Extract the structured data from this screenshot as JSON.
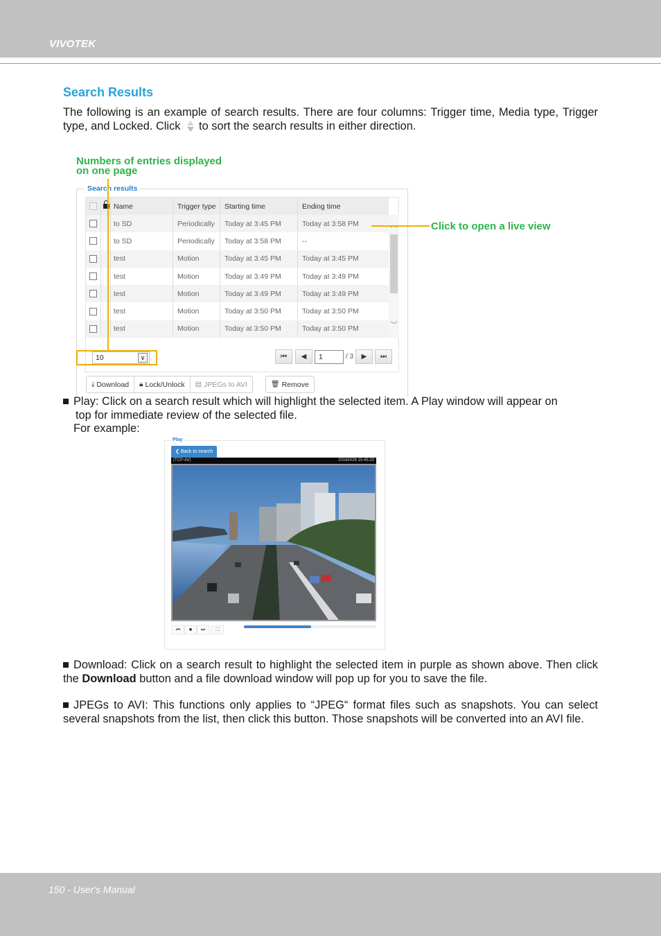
{
  "header": {
    "brand": "VIVOTEK"
  },
  "footer": {
    "page_label": "150 - User's Manual"
  },
  "section": {
    "title": "Search Results",
    "intro_part1": "The following is an example of search results. There are four columns: Trigger time, Media type, Trigger type, and Locked. Click",
    "intro_part2": "to sort the search results in either direction.",
    "sort_icon": "sort-up-down-icon"
  },
  "annotations": {
    "entries_per_page_line1": "Numbers of entries displayed",
    "entries_per_page_line2": "on one page",
    "live_view": "Click to open a live view",
    "accent_color": "#2db34a",
    "callout_color": "#f0ae00"
  },
  "search_panel": {
    "legend": "Search results",
    "columns": [
      "Name",
      "Trigger type",
      "Starting time",
      "Ending time"
    ],
    "rows": [
      {
        "name": "to SD",
        "trigger": "Periodically",
        "start": "Today at 3:45 PM",
        "end": "Today at 3:58 PM"
      },
      {
        "name": "to SD",
        "trigger": "Periodically",
        "start": "Today at 3:58 PM",
        "end": "--"
      },
      {
        "name": "test",
        "trigger": "Motion",
        "start": "Today at 3:45 PM",
        "end": "Today at 3:45 PM"
      },
      {
        "name": "test",
        "trigger": "Motion",
        "start": "Today at 3:49 PM",
        "end": "Today at 3:49 PM"
      },
      {
        "name": "test",
        "trigger": "Motion",
        "start": "Today at 3:49 PM",
        "end": "Today at 3:49 PM"
      },
      {
        "name": "test",
        "trigger": "Motion",
        "start": "Today at 3:50 PM",
        "end": "Today at 3:50 PM"
      },
      {
        "name": "test",
        "trigger": "Motion",
        "start": "Today at 3:50 PM",
        "end": "Today at 3:50 PM"
      }
    ],
    "page_size": "10",
    "current_page": "1",
    "total_pages": "/ 3",
    "pager_icons": {
      "first": "⏮",
      "prev": "◀",
      "next": "▶",
      "last": "⏭"
    },
    "actions": {
      "download": "Download",
      "lock_unlock": "Lock/Unlock",
      "jpegs_to_avi": "JPEGs to AVI",
      "remove": "Remove"
    }
  },
  "bullets": {
    "play_line1": "Play: Click on a search result which will highlight the selected item. A Play window will appear on",
    "play_line2": "top for immediate review of the selected file.",
    "play_example": "For example:",
    "download_pre": "Download: Click on a search result to highlight the selected item in purple as shown above. Then click the",
    "download_bold": "Download",
    "download_post": "button and a file download window will pop up for you to save the file.",
    "jpegs_text": "JPEGs to AVI: This functions only applies to “JPEG“ format files such as snapshots. You can select several snapshots from the list, then click this button. Those snapshots will be converted into an AVI file."
  },
  "play_window": {
    "legend": "Play",
    "back_label": "Back to search",
    "stream_label": "(TCP-AV)",
    "timestamp": "2016/0/26 15:45:20",
    "playback_progress": 0.51,
    "progress_color": "#3f83c4"
  }
}
